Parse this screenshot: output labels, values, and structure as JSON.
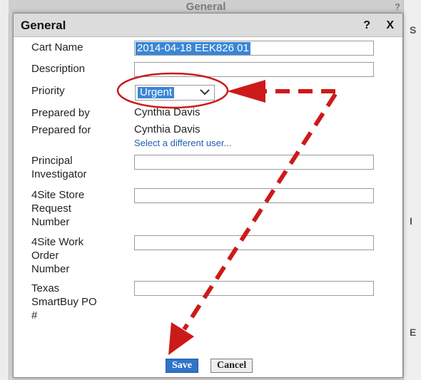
{
  "background": {
    "header_title": "General",
    "header_help": "?",
    "side_letters": [
      "S",
      "I",
      "E"
    ]
  },
  "dialog": {
    "title": "General",
    "help_label": "?",
    "close_label": "X"
  },
  "form": {
    "cart_name_label": "Cart Name",
    "cart_name_value": "2014-04-18 EEK826 01",
    "description_label": "Description",
    "description_value": "",
    "priority_label": "Priority",
    "priority_value": "Urgent",
    "prepared_by_label": "Prepared by",
    "prepared_by_value": "Cynthia Davis",
    "prepared_for_label": "Prepared for",
    "prepared_for_value": "Cynthia Davis",
    "select_user_link": "Select a different user...",
    "principal_investigator_label_1": "Principal",
    "principal_investigator_label_2": "Investigator",
    "store_request_label_1": "4Site Store",
    "store_request_label_2": "Request",
    "store_request_label_3": "Number",
    "work_order_label_1": "4Site Work",
    "work_order_label_2": "Order",
    "work_order_label_3": "Number",
    "smartbuy_label_1": "Texas",
    "smartbuy_label_2": "SmartBuy PO",
    "smartbuy_label_3": "#"
  },
  "buttons": {
    "save": "Save",
    "cancel": "Cancel"
  },
  "annotation": {
    "arrow_color": "#cc1a1a",
    "circle_color": "#cc1a1a"
  }
}
